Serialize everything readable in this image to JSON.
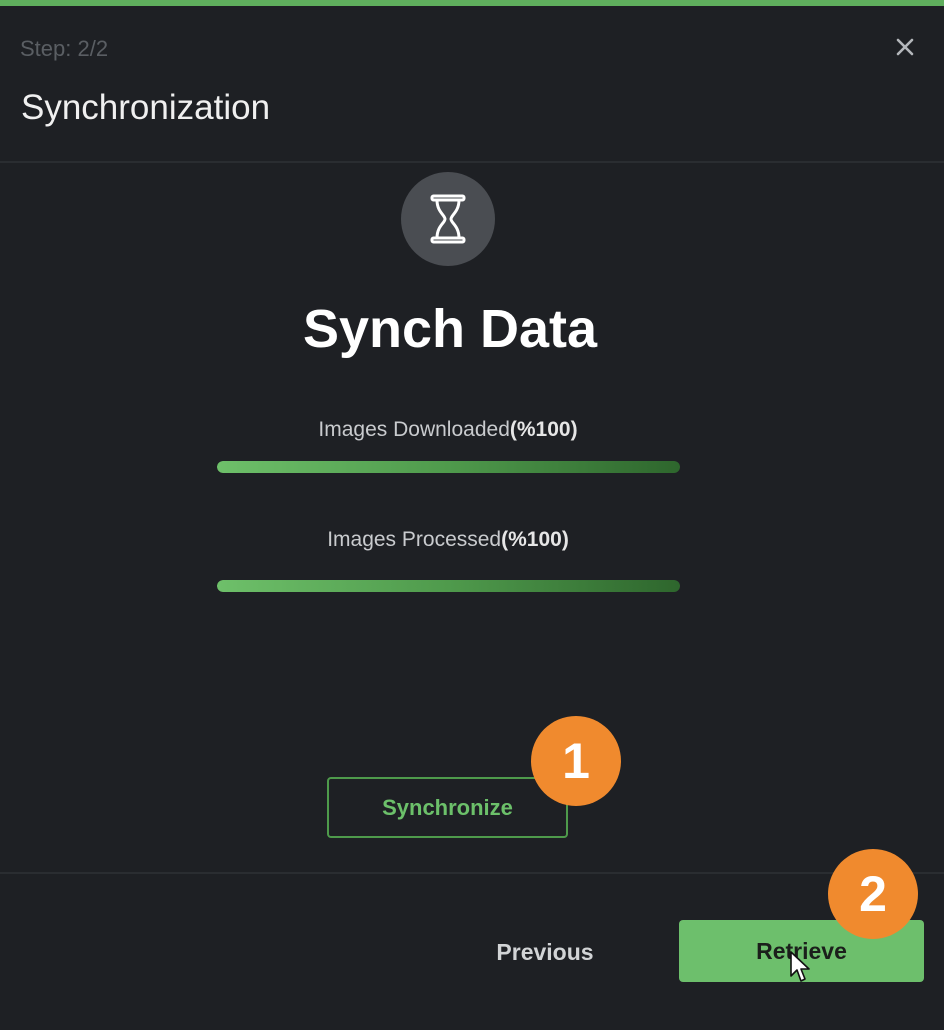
{
  "dialog": {
    "step_text": "Step: 2/2",
    "title": "Synchronization"
  },
  "icons": {
    "close": "close-icon",
    "status": "hourglass-icon"
  },
  "content": {
    "heading": "Synch Data",
    "progress": [
      {
        "label": "Images Downloaded",
        "percent_text": "(%100)",
        "percent": 100
      },
      {
        "label": "Images Processed",
        "percent_text": "(%100)",
        "percent": 100
      }
    ]
  },
  "buttons": {
    "synchronize": "Synchronize",
    "previous": "Previous",
    "retrieve": "Retrieve"
  },
  "annotations": {
    "badge_1": "1",
    "badge_2": "2"
  },
  "colors": {
    "accent": "#5fae5d",
    "primary_button": "#6dbf6c",
    "badge": "#f08a2e",
    "background": "#1e2024"
  }
}
